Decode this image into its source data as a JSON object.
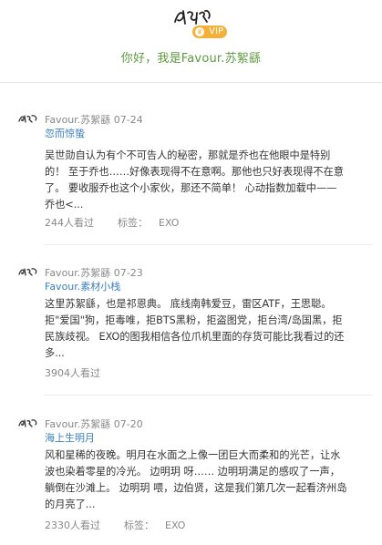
{
  "header": {
    "avatar_icon": "signature-logo-icon",
    "vip_label": "VIP",
    "greeting": "你好，我是Favour.苏絮繇"
  },
  "posts": [
    {
      "meta": "Favour.苏絮繇 07-24",
      "title": "忽而惊蛰",
      "body_lines": [
        "吴世勋自认为有个不可告人的秘密，那就是乔也在他眼中是特别",
        "的！ 至于乔也……好像表现得不在意啊。那他也只好表现得不在意",
        "了。 要收服乔也这个小家伙，那还不简单！ 心动指数加载中——",
        "乔也<..."
      ],
      "views": "244人看过",
      "tag_label": "标签：",
      "tag": "EXO"
    },
    {
      "meta": "Favour.苏絮繇 07-23",
      "title": "Favour.素材小栈",
      "body_lines": [
        "这里苏絮繇，也是祁恩典。 底线南韩爱豆，雷区ATF，王思聪。",
        "拒\"爱国\"狗，拒毒唯，拒BTS黑粉，拒盗图党，拒台湾/岛国黑，拒",
        "民族歧视。 EXO的图我相信各位爪机里面的存货可能比我看过的还",
        "多..."
      ],
      "views": "3904人看过",
      "tag_label": "",
      "tag": ""
    },
    {
      "meta": "Favour.苏絮繇 07-20",
      "title": "海上生明月",
      "body_lines": [
        "风和星稀的夜晚。明月在水面之上像一团巨大而柔和的光芒，让水",
        "波也染着零星的冷光。 边明玥 呀…… 边明玥满足的感叹了一声，",
        "躺倒在沙滩上。 边明玥 喂，边伯贤，这是我们第几次一起看济州岛",
        "的月亮了..."
      ],
      "views": "2330人看过",
      "tag_label": "标签：",
      "tag": "EXO"
    }
  ]
}
